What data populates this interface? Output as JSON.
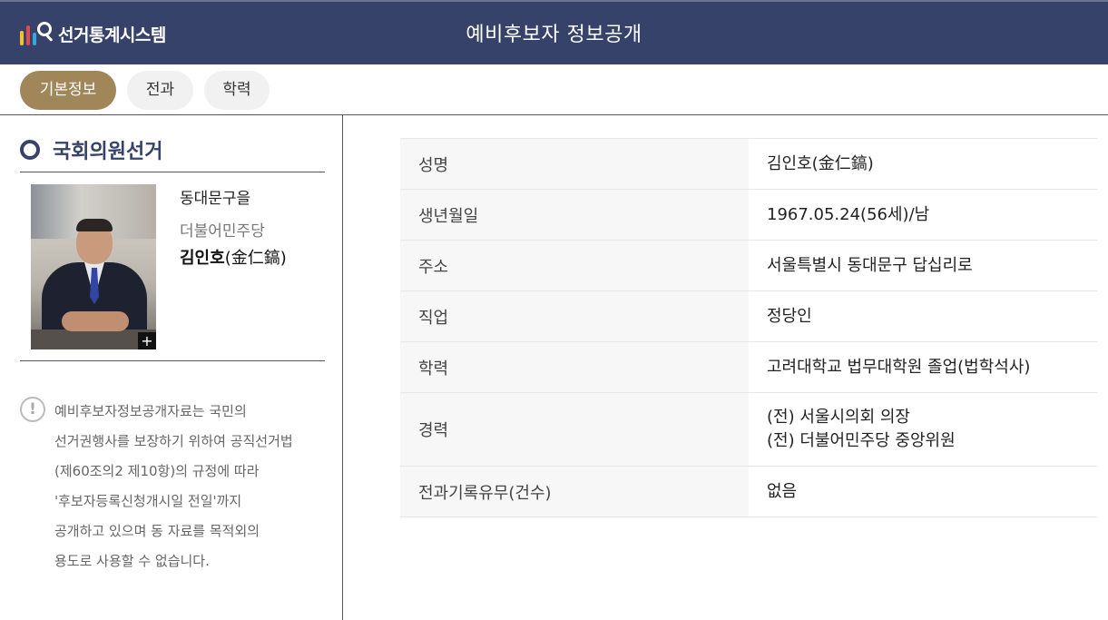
{
  "header": {
    "logo_text": "선거통계시스템",
    "title": "예비후보자 정보공개"
  },
  "tabs": [
    {
      "label": "기본정보",
      "active": true
    },
    {
      "label": "전과",
      "active": false
    },
    {
      "label": "학력",
      "active": false
    }
  ],
  "sidebar": {
    "section_title": "국회의원선거",
    "candidate": {
      "district": "동대문구을",
      "party": "더불어민주당",
      "name_hangul": "김인호",
      "name_hanja": "(金仁鎬)",
      "photo_expand": "+"
    },
    "notice": {
      "icon": "!",
      "lines": [
        "예비후보자정보공개자료는 국민의",
        "선거권행사를 보장하기 위하여 공직선거법",
        "(제60조의2 제10항)의 규정에 따라",
        "'후보자등록신청개시일 전일'까지",
        "공개하고 있으며 동 자료를 목적외의",
        "용도로 사용할 수 없습니다."
      ]
    }
  },
  "info_table": {
    "rows": [
      {
        "label": "성명",
        "value": [
          "김인호(金仁鎬)"
        ]
      },
      {
        "label": "생년월일",
        "value": [
          "1967.05.24(56세)/남"
        ]
      },
      {
        "label": "주소",
        "value": [
          "서울특별시 동대문구 답십리로"
        ]
      },
      {
        "label": "직업",
        "value": [
          "정당인"
        ]
      },
      {
        "label": "학력",
        "value": [
          "고려대학교 법무대학원 졸업(법학석사)"
        ]
      },
      {
        "label": "경력",
        "value": [
          "(전) 서울시의회 의장",
          "(전) 더불어민주당 중앙위원"
        ]
      },
      {
        "label": "전과기록유무(건수)",
        "value": [
          "없음"
        ]
      }
    ]
  },
  "colors": {
    "header_bg": "#36426a",
    "active_tab": "#a1865a"
  }
}
